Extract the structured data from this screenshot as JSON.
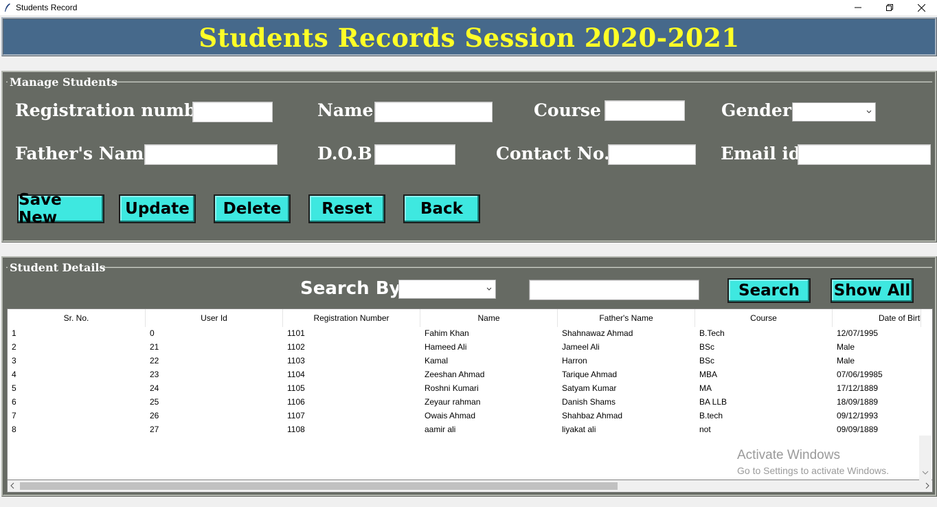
{
  "window": {
    "title": "Students Record"
  },
  "banner": {
    "title": "Students Records Session 2020-2021"
  },
  "manage": {
    "legend": "Manage Students",
    "fields": {
      "registration_label": "Registration number",
      "name_label": "Name",
      "course_label": "Course",
      "gender_label": "Gender",
      "father_label": "Father's Name",
      "dob_label": "D.O.B",
      "contact_label": "Contact No.",
      "email_label": "Email id"
    },
    "buttons": {
      "save": "Save New",
      "update": "Update",
      "delete": "Delete",
      "reset": "Reset",
      "back": "Back"
    }
  },
  "details": {
    "legend": "Student Details",
    "search_by_label": "Search By",
    "search_button": "Search",
    "show_all_button": "Show All"
  },
  "table": {
    "columns": [
      "Sr. No.",
      "User Id",
      "Registration Number",
      "Name",
      "Father's Name",
      "Course",
      "Date of Birth"
    ],
    "rows": [
      [
        "1",
        "0",
        "1101",
        "Fahim Khan",
        "Shahnawaz Ahmad",
        "B.Tech",
        "12/07/1995"
      ],
      [
        "2",
        "21",
        "1102",
        "Hameed Ali",
        "Jameel Ali",
        "BSc",
        "Male"
      ],
      [
        "3",
        "22",
        "1103",
        "Kamal",
        "Harron",
        "BSc",
        "Male"
      ],
      [
        "4",
        "23",
        "1104",
        "Zeeshan Ahmad",
        "Tarique Ahmad",
        "MBA",
        "07/06/19985"
      ],
      [
        "5",
        "24",
        "1105",
        "Roshni Kumari",
        "Satyam Kumar",
        "MA",
        "17/12/1889"
      ],
      [
        "6",
        "25",
        "1106",
        "Zeyaur rahman",
        "Danish Shams",
        "BA LLB",
        "18/09/1889"
      ],
      [
        "7",
        "26",
        "1107",
        "Owais Ahmad",
        "Shahbaz Ahmad",
        "B.tech",
        "09/12/1993"
      ],
      [
        "8",
        "27",
        "1108",
        "aamir ali",
        "liyakat ali",
        "not",
        "09/09/1889"
      ]
    ]
  },
  "watermark": {
    "title": "Activate Windows",
    "subtitle": "Go to Settings to activate Windows."
  },
  "colors": {
    "banner_bg": "#46698b",
    "banner_text": "#ffff27",
    "frame_bg": "#666a63",
    "button_bg": "#3ee8e0"
  }
}
